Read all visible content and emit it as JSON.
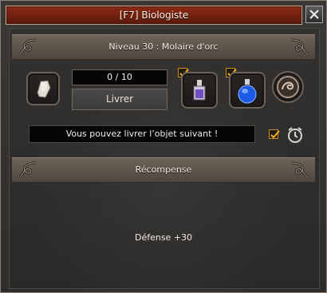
{
  "window": {
    "title": "[F7] Biologiste",
    "close_icon": "close-x-icon"
  },
  "mission": {
    "header": "Niveau 30 : Molaire d'orc",
    "item_icon": "orc-molar-icon",
    "count": "0 / 10",
    "deliver_label": "Livrer",
    "potion1_icon": "purple-potion-icon",
    "potion1_checked": true,
    "potion2_icon": "blue-potion-icon",
    "potion2_checked": true,
    "emblem_icon": "dragon-emblem-icon"
  },
  "status": {
    "message": "Vous pouvez livrer l’objet suivant !",
    "checkbox_checked": true,
    "alarm_icon": "alarm-clock-icon"
  },
  "reward": {
    "header": "Récompense",
    "text": "Défense +30"
  },
  "colors": {
    "title_bar": "#6e1f0f",
    "panel_bg": "#2f2d2b",
    "header_bar": "#5c5248",
    "checkbox_accent": "#c98d19"
  }
}
